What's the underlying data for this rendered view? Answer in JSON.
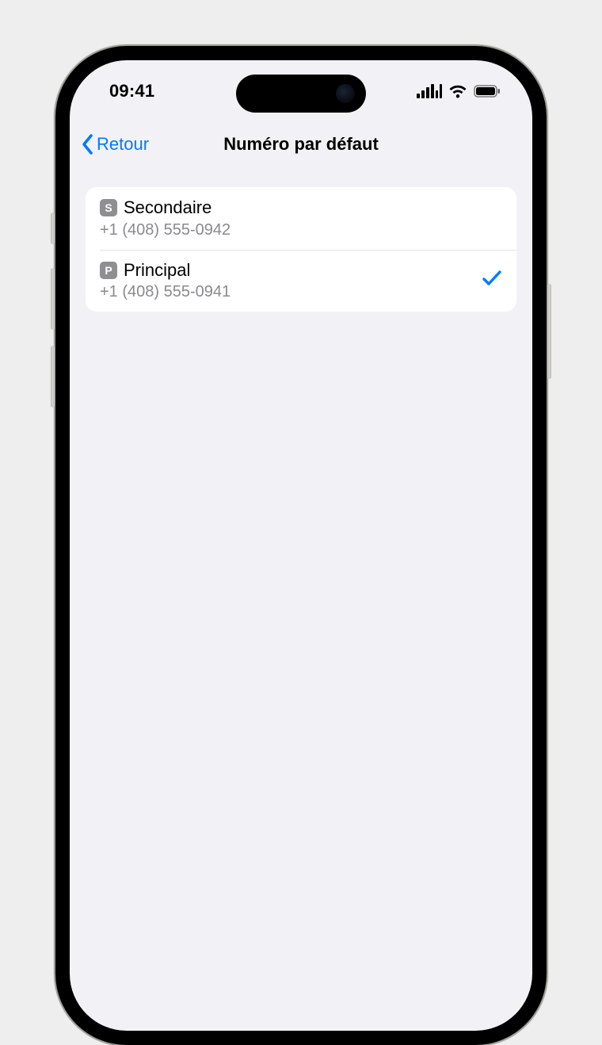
{
  "status": {
    "time": "09:41"
  },
  "nav": {
    "back_label": "Retour",
    "title": "Numéro par défaut"
  },
  "lines": [
    {
      "badge": "S",
      "label": "Secondaire",
      "number": "+1 (408) 555-0942",
      "selected": false
    },
    {
      "badge": "P",
      "label": "Principal",
      "number": "+1 (408) 555-0941",
      "selected": true
    }
  ],
  "colors": {
    "accent": "#007aff",
    "bg": "#f2f2f6",
    "secondary_text": "#8a8a8e"
  }
}
